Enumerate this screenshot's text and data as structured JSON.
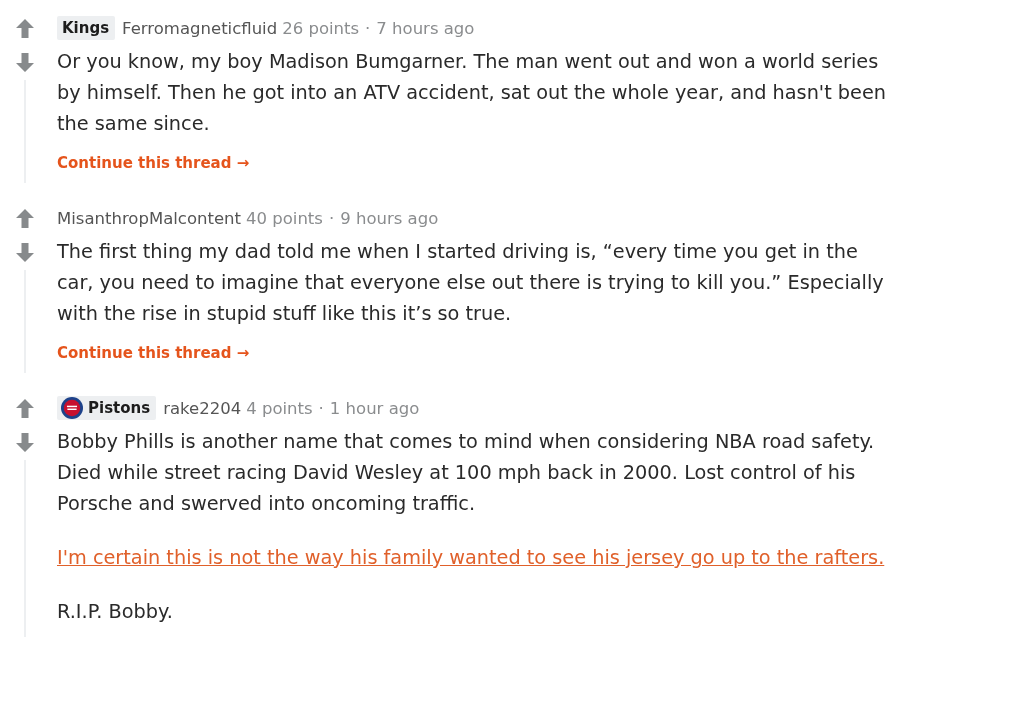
{
  "comments": [
    {
      "flair": {
        "text": "Kings",
        "icon": false
      },
      "author": "Ferromagneticfluid",
      "points": "26 points",
      "separator": "·",
      "time": "7 hours ago",
      "paragraphs": [
        {
          "kind": "text",
          "text": "Or you know, my boy Madison Bumgarner. The man went out and won a world series by himself. Then he got into an ATV accident, sat out the whole year, and hasn't been the same since."
        }
      ],
      "continue_link": "Continue this thread →"
    },
    {
      "author": "MisanthropMalcontent",
      "points": "40 points",
      "separator": "·",
      "time": "9 hours ago",
      "paragraphs": [
        {
          "kind": "text",
          "text": "The first thing my dad told me when I started driving is, “every time you get in the car, you need to imagine that everyone else out there is trying to kill you.” Especially with the rise in stupid stuff like this it’s so true."
        }
      ],
      "continue_link": "Continue this thread →"
    },
    {
      "flair": {
        "text": "Pistons",
        "icon": true
      },
      "author": "rake2204",
      "points": "4 points",
      "separator": "·",
      "time": "1 hour ago",
      "paragraphs": [
        {
          "kind": "text",
          "text": "Bobby Phills is another name that comes to mind when considering NBA road safety. Died while street racing David Wesley at 100 mph back in 2000. Lost control of his Porsche and swerved into oncoming traffic."
        },
        {
          "kind": "link",
          "text": "I'm certain this is not the way his family wanted to see his jersey go up to the rafters."
        },
        {
          "kind": "text",
          "text": "R.I.P. Bobby."
        }
      ]
    }
  ]
}
